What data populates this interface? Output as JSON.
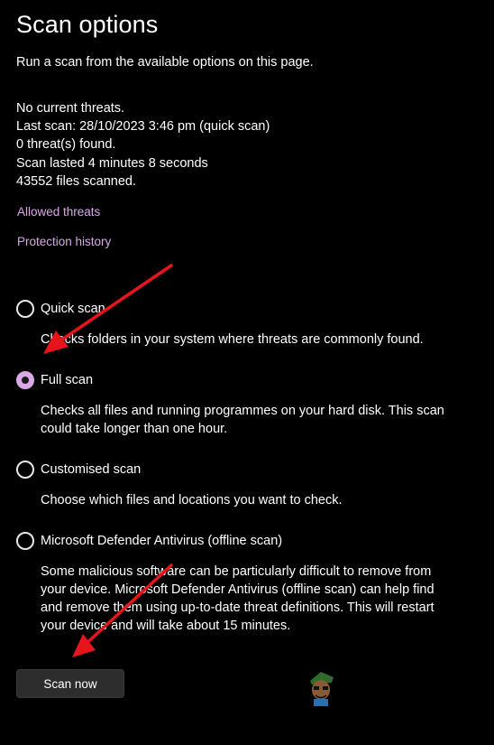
{
  "page": {
    "title": "Scan options",
    "subtitle": "Run a scan from the available options on this page."
  },
  "status": {
    "lines": [
      "No current threats.",
      "Last scan: 28/10/2023 3:46 pm (quick scan)",
      "0 threat(s) found.",
      "Scan lasted 4 minutes 8 seconds",
      "43552 files scanned."
    ]
  },
  "links": {
    "allowed_threats": "Allowed threats",
    "protection_history": "Protection history"
  },
  "options": [
    {
      "label": "Quick scan",
      "selected": false,
      "desc_lines": [
        "Checks folders in your system where threats are commonly found."
      ]
    },
    {
      "label": "Full scan",
      "selected": true,
      "desc_lines": [
        "Checks all files and running programmes on your hard disk. This scan",
        "could take longer than one hour."
      ]
    },
    {
      "label": "Customised scan",
      "selected": false,
      "desc_lines": [
        "Choose which files and locations you want to check."
      ]
    },
    {
      "label": "Microsoft Defender Antivirus (offline scan)",
      "selected": false,
      "desc_lines": [
        "Some malicious software can be particularly difficult to remove from",
        "your device. Microsoft Defender Antivirus (offline scan) can help find",
        "and remove them using up-to-date threat definitions. This will restart",
        "your device and will take about 15 minutes."
      ]
    }
  ],
  "actions": {
    "scan_now_label": "Scan now"
  },
  "colors": {
    "background": "#000000",
    "text": "#ffffff",
    "accent": "#d8a8e8",
    "button_bg": "#2d2d2d",
    "annotation_arrow": "#e8141c"
  },
  "icons": {
    "annotation": "red-arrow-icon",
    "watermark": "appuals-mascot-icon"
  }
}
